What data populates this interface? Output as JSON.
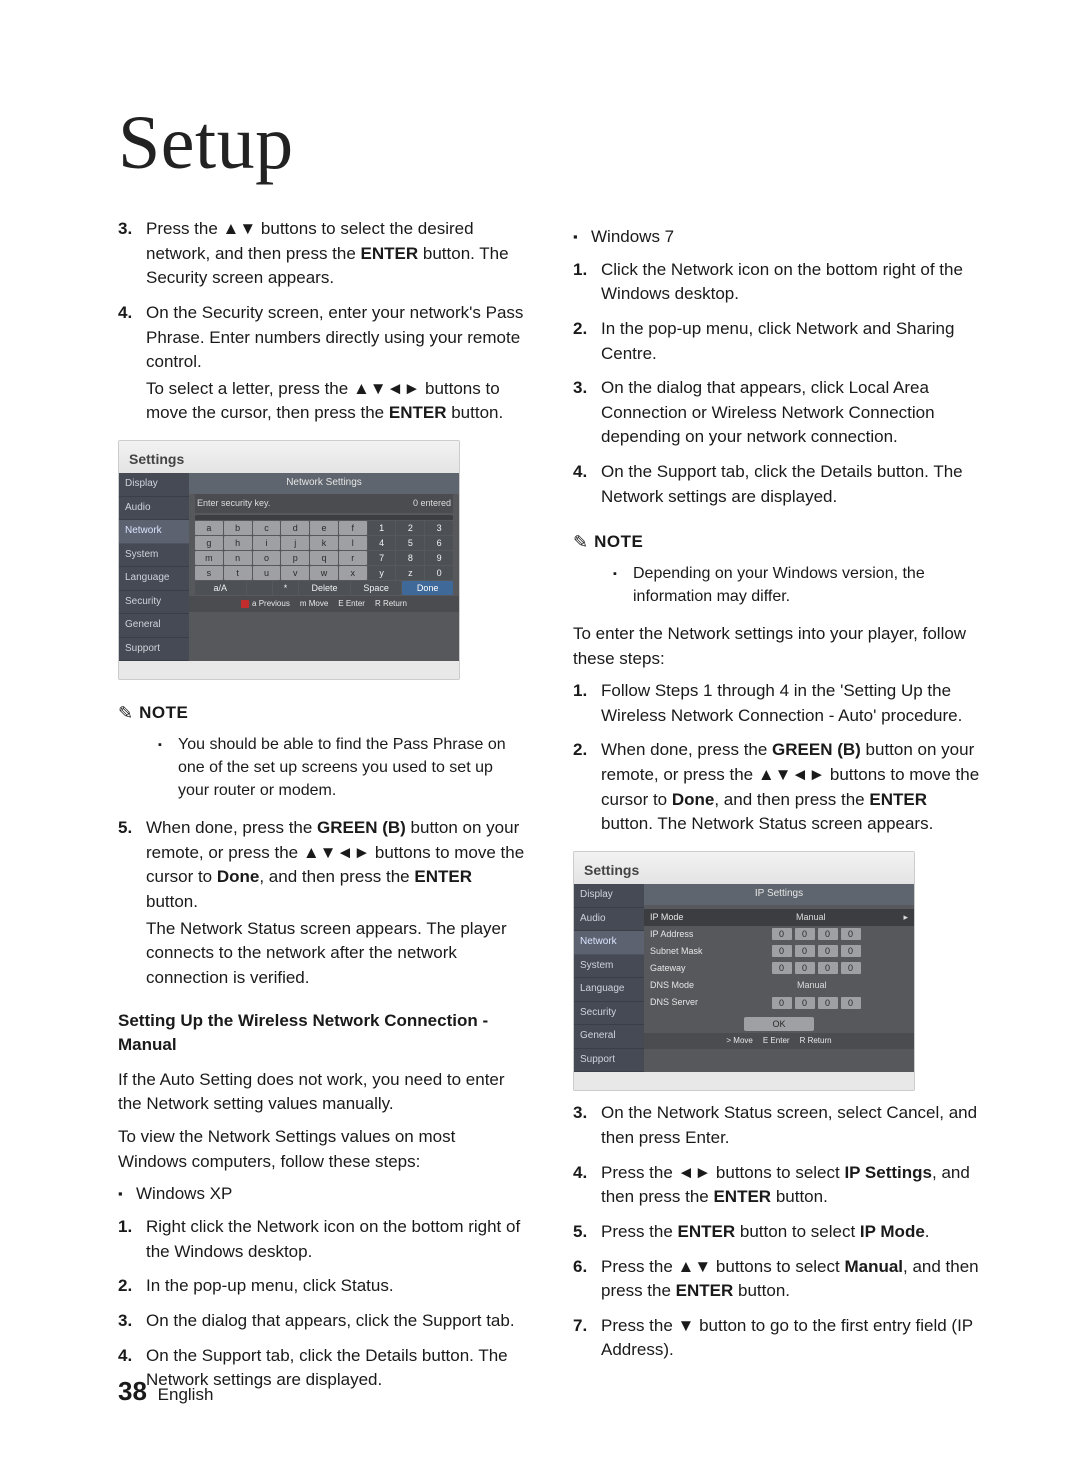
{
  "title": "Setup",
  "footer": {
    "page": "38",
    "lang": "English"
  },
  "left": {
    "step3_pre": "Press the ",
    "step3_btns": "▲▼",
    "step3_mid": " buttons to select the desired network, and then press the ",
    "step3_enter": "ENTER",
    "step3_post": " button. The Security screen appears.",
    "step4_a": "On the Security screen, enter your network's Pass Phrase. Enter numbers directly using your remote control.",
    "step4_b_pre": "To select a letter, press the ",
    "step4_b_btns": "▲▼◄►",
    "step4_b_mid": " buttons to move the cursor, then press the ",
    "step4_b_enter": "ENTER",
    "step4_b_post": " button.",
    "note_label": "NOTE",
    "note1": "You should be able to find the Pass Phrase on one of the set up screens you used to set up your router or modem.",
    "step5_pre": "When done, press the ",
    "step5_green": "GREEN (B)",
    "step5_mid1": " button on your remote, or press the ",
    "step5_btns": "▲▼◄►",
    "step5_mid2": " buttons to move the cursor to ",
    "step5_done": "Done",
    "step5_mid3": ", and then press the ",
    "step5_enter": "ENTER",
    "step5_post1": " button.",
    "step5_post2": "The Network Status screen appears. The player connects to the network after the network connection is verified.",
    "section_head": "Setting Up the Wireless Network Connection - Manual",
    "manual_p1": "If the Auto Setting does not work, you need to enter the Network setting values manually.",
    "manual_p2": "To view the Network Settings values on most Windows computers, follow these steps:",
    "winxp": "Windows XP",
    "xp1": "Right click the Network icon on the bottom right of the Windows desktop.",
    "xp2": "In the pop-up menu, click Status.",
    "xp3": "On the dialog that appears, click the Support tab.",
    "xp4": "On the Support tab, click the Details button. The Network settings are displayed."
  },
  "right": {
    "win7": "Windows 7",
    "w1": "Click the Network icon on the bottom right of the Windows desktop.",
    "w2": "In the pop-up menu, click Network and Sharing Centre.",
    "w3": "On the dialog that appears, click Local Area Connection or Wireless Network Connection depending on your network connection.",
    "w4": "On the Support tab, click the Details button. The Network settings are displayed.",
    "note_label": "NOTE",
    "note2": "Depending on your Windows version, the information may differ.",
    "enter_p": "To enter the Network settings into your player, follow these steps:",
    "s1": "Follow Steps 1 through 4 in the 'Setting Up the Wireless Network Connection - Auto' procedure.",
    "s2_pre": "When done, press the ",
    "s2_green": "GREEN (B)",
    "s2_mid1": " button on your remote, or press the ",
    "s2_btns": "▲▼◄►",
    "s2_mid2": " buttons to move the cursor to ",
    "s2_done": "Done",
    "s2_mid3": ", and then press the ",
    "s2_enter": "ENTER",
    "s2_post": " button. The Network Status screen appears.",
    "s3": "On the Network Status screen, select Cancel, and then press Enter.",
    "s4_pre": "Press the ",
    "s4_btns": "◄►",
    "s4_mid": " buttons to select ",
    "s4_ip": "IP Settings",
    "s4_mid2": ", and then press the ",
    "s4_enter": "ENTER",
    "s4_post": " button.",
    "s5_pre": "Press the ",
    "s5_enter": "ENTER",
    "s5_mid": " button to select ",
    "s5_ipmode": "IP Mode",
    "s5_post": ".",
    "s6_pre": "Press the ",
    "s6_btns": "▲▼",
    "s6_mid": " buttons to select ",
    "s6_manual": "Manual",
    "s6_mid2": ", and then press the ",
    "s6_enter": "ENTER",
    "s6_post": " button.",
    "s7_pre": "Press the ",
    "s7_btn": "▼",
    "s7_post": " button to go to the first entry field (IP Address)."
  },
  "panel1": {
    "title": "Settings",
    "heading": "Network Settings",
    "enter_key": "Enter security key.",
    "entered": "0 entered",
    "side": [
      "Display",
      "Audio",
      "Network",
      "System",
      "Language",
      "Security",
      "General",
      "Support"
    ],
    "kbrows": [
      [
        "a",
        "b",
        "c",
        "d",
        "e",
        "f",
        "1",
        "2",
        "3"
      ],
      [
        "g",
        "h",
        "i",
        "j",
        "k",
        "l",
        "4",
        "5",
        "6"
      ],
      [
        "m",
        "n",
        "o",
        "p",
        "q",
        "r",
        "7",
        "8",
        "9"
      ],
      [
        "s",
        "t",
        "u",
        "v",
        "w",
        "x",
        "y",
        "z",
        "0"
      ]
    ],
    "bottom": [
      "a/A",
      "",
      "*",
      "Delete",
      "Space",
      "Done"
    ],
    "foot": [
      "a Previous",
      "m Move",
      "E Enter",
      "R Return"
    ]
  },
  "panel2": {
    "title": "Settings",
    "heading": "IP Settings",
    "side": [
      "Display",
      "Audio",
      "Network",
      "System",
      "Language",
      "Security",
      "General",
      "Support"
    ],
    "rows": [
      {
        "label": "IP Mode",
        "mode": "Manual"
      },
      {
        "label": "IP Address",
        "seg": [
          "0",
          "0",
          "0",
          "0"
        ]
      },
      {
        "label": "Subnet Mask",
        "seg": [
          "0",
          "0",
          "0",
          "0"
        ]
      },
      {
        "label": "Gateway",
        "seg": [
          "0",
          "0",
          "0",
          "0"
        ]
      },
      {
        "label": "DNS Mode",
        "mode": "Manual"
      },
      {
        "label": "DNS Server",
        "seg": [
          "0",
          "0",
          "0",
          "0"
        ]
      }
    ],
    "ok": "OK",
    "foot": [
      "> Move",
      "E Enter",
      "R Return"
    ]
  }
}
